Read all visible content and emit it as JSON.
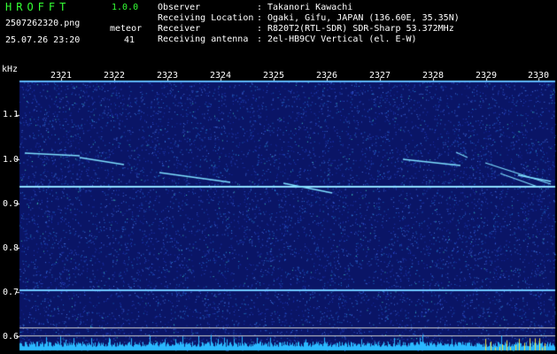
{
  "header": {
    "app_title": "HROFFT",
    "app_version": "1.0.0",
    "file_name": "2507262320.png",
    "timestamp": "25.07.26 23:20",
    "meteor_label": "meteor",
    "meteor_count": "41"
  },
  "station_info": [
    {
      "key": "Observer",
      "sep": ":",
      "value": "Takanori Kawachi"
    },
    {
      "key": "Receiving Location",
      "sep": ":",
      "value": "Ogaki, Gifu, JAPAN (136.60E, 35.35N)"
    },
    {
      "key": "Receiver",
      "sep": ":",
      "value": "R820T2(RTL-SDR) SDR-Sharp 53.372MHz"
    },
    {
      "key": "Receiving antenna",
      "sep": ":",
      "value": "2el-HB9CV Vertical (el. E-W)"
    }
  ],
  "axes": {
    "y_unit": "kHz",
    "y_ticks": [
      "1.1",
      "1.0",
      "0.9",
      "0.8",
      "0.7",
      "0.6"
    ],
    "time_ticks": [
      "2321",
      "2322",
      "2323",
      "2324",
      "2325",
      "2326",
      "2327",
      "2328",
      "2329",
      "2330"
    ]
  },
  "colors": {
    "background_noise": "#0c1a7a",
    "signal": "#6fd6ff",
    "header_green": "#34ff34",
    "text": "#ffffff"
  }
}
